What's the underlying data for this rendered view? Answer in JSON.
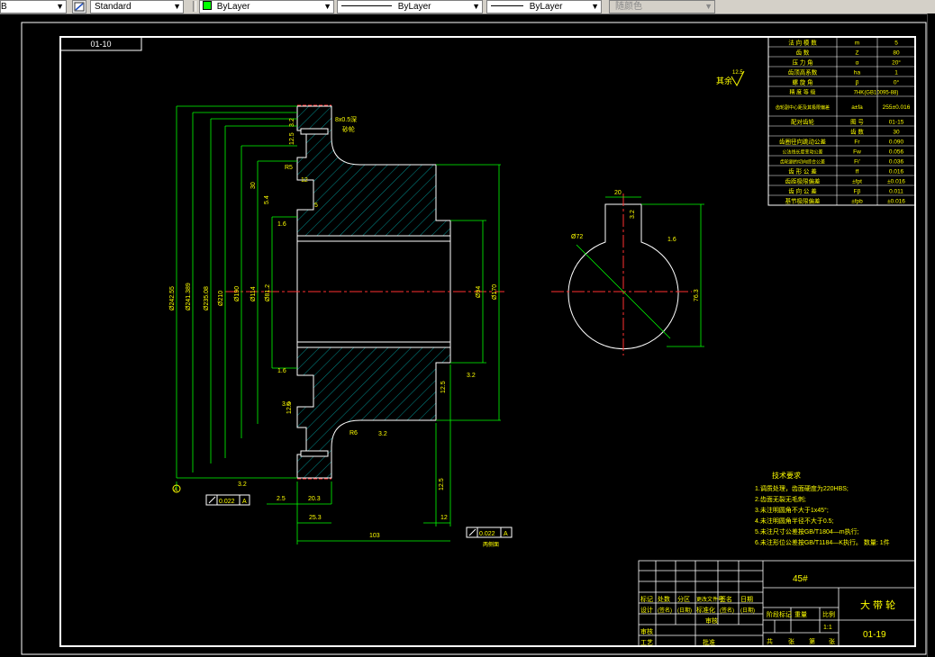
{
  "toolbar": {
    "layer_fragment": "B",
    "text_style": "Standard",
    "layer": "ByLayer",
    "linetype": "ByLayer",
    "lineweight": "ByLayer",
    "plot_style": "随颜色",
    "layer_color": "#00ff00"
  },
  "drawing": {
    "label_topleft": "01-10",
    "remainder_roughness": "其余",
    "roughness_12_5": "12.5",
    "left_view_dims": [
      "Ø242.55",
      "Ø241.389",
      "Ø235.08",
      "Ø210",
      "Ø190",
      "Ø114",
      "Ø81.2"
    ],
    "dim_30": "30",
    "dim_5_4": "5.4",
    "dim_R5": "R5",
    "dim_12": "12",
    "dim_5": "5",
    "dim_8d": "8",
    "roughness_1_6": "1.6",
    "roughness_3_2": "3.2",
    "roughness_6_3": "6.3",
    "roughness_12": "12.5",
    "dim_phi_94": "Ø94",
    "dim_phi_170": "Ø170",
    "dim_2_5": "2.5",
    "dim_20_3": "20.3",
    "dim_25_3": "25.3",
    "dim_103": "103",
    "dim_12b": "12",
    "datum_A": "A",
    "tol_runout_1": "0.022",
    "tol_runout_2": "0.022",
    "tol_note": "两侧面",
    "note_chamfer": "R6",
    "key_width": "20",
    "key_phi": "Ø72",
    "key_dim": "76.3",
    "groove_note": "8x0.5深",
    "groove_note2": "砂轮",
    "flat_note": "R5"
  },
  "params": {
    "rows": [
      [
        "法 向 模 数",
        "m",
        "5"
      ],
      [
        "齿 数",
        "Z",
        "80"
      ],
      [
        "压 力 角",
        "α",
        "20°"
      ],
      [
        "齿顶高系数",
        "ha",
        "1"
      ],
      [
        "螺 旋 角",
        "β",
        "0°"
      ],
      [
        "精 度 等 级",
        "7HK(GB10095-88)"
      ],
      [
        "齿轮副中心距及其极限偏差",
        "a±fa",
        "255±0.016"
      ],
      [
        "配对齿轮",
        "图 号",
        "01-15"
      ],
      [
        "",
        "齿 数",
        "30"
      ],
      [
        "齿圈径向跳动公差",
        "Fr",
        "0.090"
      ],
      [
        "公法线长度变动公差",
        "Fw",
        "0.056"
      ],
      [
        "齿轮副的切向综合公差",
        "Fi'",
        "0.036"
      ],
      [
        "齿 形 公 差",
        "ff",
        "0.016"
      ],
      [
        "齿距极限偏差",
        "±fpt",
        "±0.016"
      ],
      [
        "齿 向 公 差",
        "Fβ",
        "0.011"
      ],
      [
        "基节极限偏差",
        "±fpb",
        "±0.016"
      ]
    ]
  },
  "notes": {
    "title": "技术要求",
    "items": [
      "1.调质处理，齿面硬度为220HBS;",
      "2.齿面无裂无毛刺;",
      "3.未注明圆角不大于1x45°;",
      "4.未注明圆角半径不大于0.5;",
      "5.未注尺寸公差按GB/T1804—m执行;",
      "6.未注形位公差按GB/T1184—K执行。  数量: 1件"
    ]
  },
  "titleblock": {
    "material": "45#",
    "part_name": "大 带 轮",
    "drawing_no": "01-19",
    "scale": "1:1",
    "header_labels": [
      "标记",
      "处数",
      "分区",
      "更改文件号",
      "签名",
      "日期"
    ],
    "row2": [
      "设计",
      "(签名)",
      "(日期)",
      "标准化",
      "(签名)",
      "(日期)"
    ],
    "stage_label": "阶段标记",
    "weight_label": "重量",
    "scale_label": "比例",
    "review": "审核",
    "process": "工艺",
    "approve": "批准",
    "sheets": [
      "共",
      "张",
      "第",
      "张"
    ]
  }
}
